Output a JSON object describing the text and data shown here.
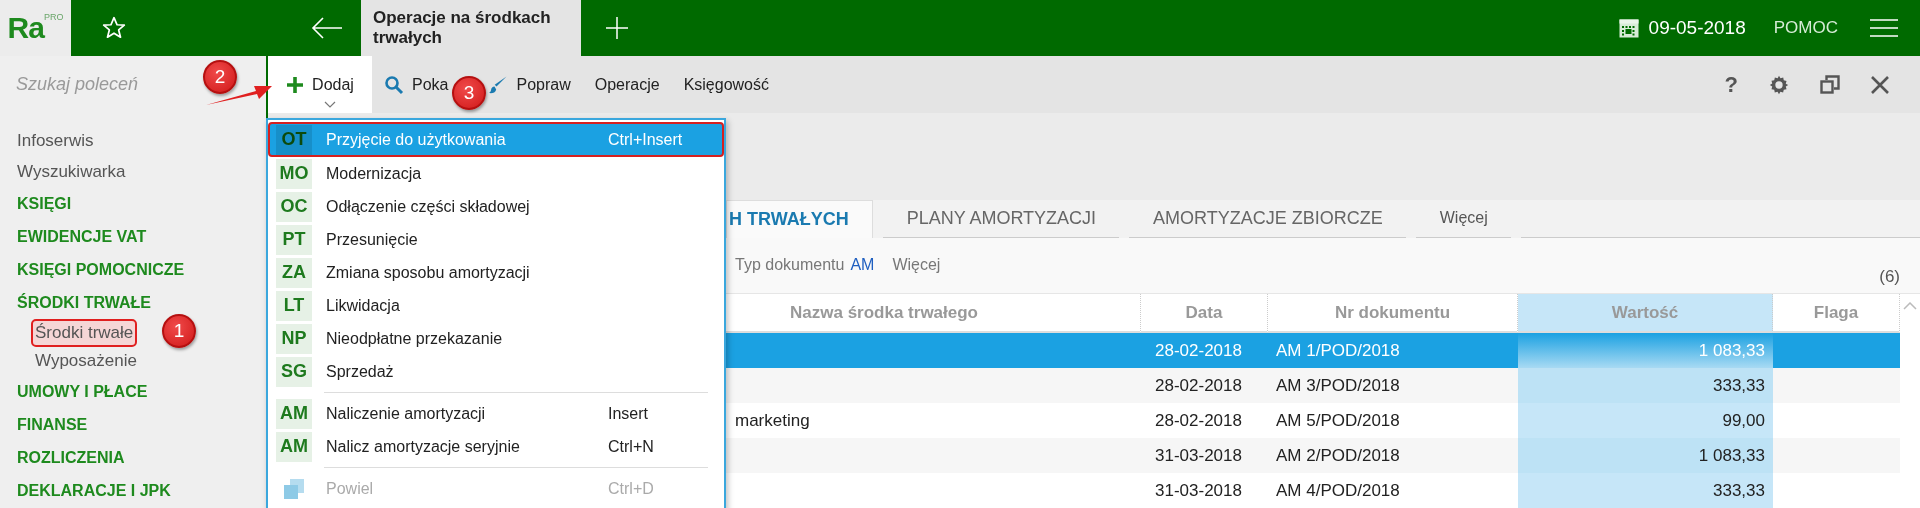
{
  "top_bar": {
    "logo": {
      "text": "Ra",
      "superscript": "PRO"
    },
    "document_tab": {
      "title": "Operacje na środkach trwałych"
    },
    "date": "09-05-2018",
    "help_link": "POMOC"
  },
  "search": {
    "placeholder": "Szukaj poleceń"
  },
  "toolbar": {
    "items": [
      {
        "label": "Dodaj",
        "expanded": true,
        "annotation": "2"
      },
      {
        "label": "Poka",
        "expanded": false
      },
      {
        "label": "Popraw",
        "expanded": false
      },
      {
        "label": "Operacje",
        "expanded": false
      },
      {
        "label": "Księgowość",
        "expanded": false
      }
    ],
    "help_button": "?"
  },
  "sidebar": {
    "items": [
      {
        "label": "Infoserwis",
        "kind": "link"
      },
      {
        "label": "Wyszukiwarka",
        "kind": "link"
      },
      {
        "label": "KSIĘGI",
        "kind": "section"
      },
      {
        "label": "EWIDENCJE VAT",
        "kind": "section"
      },
      {
        "label": "KSIĘGI POMOCNICZE",
        "kind": "section"
      },
      {
        "label": "ŚRODKI TRWAŁE",
        "kind": "section",
        "children": [
          {
            "label": "Środki trwałe",
            "annotation": "1"
          },
          {
            "label": "Wyposażenie"
          }
        ]
      },
      {
        "label": "UMOWY I PŁACE",
        "kind": "section"
      },
      {
        "label": "FINANSE",
        "kind": "section"
      },
      {
        "label": "ROZLICZENIA",
        "kind": "section"
      },
      {
        "label": "DEKLARACJE I JPK",
        "kind": "section"
      }
    ]
  },
  "menu": {
    "groups": [
      [
        {
          "code": "OT",
          "label": "Przyjęcie do użytkowania",
          "shortcut": "Ctrl+Insert",
          "selected": true,
          "disabled": false,
          "annotation": "3"
        },
        {
          "code": "MO",
          "label": "Modernizacja",
          "selected": false,
          "disabled": false
        },
        {
          "code": "OC",
          "label": "Odłączenie części składowej",
          "selected": false,
          "disabled": false
        },
        {
          "code": "PT",
          "label": "Przesunięcie",
          "selected": false,
          "disabled": false
        },
        {
          "code": "ZA",
          "label": "Zmiana sposobu amortyzacji",
          "selected": false,
          "disabled": false
        },
        {
          "code": "LT",
          "label": "Likwidacja",
          "selected": false,
          "disabled": false
        },
        {
          "code": "NP",
          "label": "Nieodpłatne przekazanie",
          "selected": false,
          "disabled": false
        },
        {
          "code": "SG",
          "label": "Sprzedaż",
          "selected": false,
          "disabled": false
        }
      ],
      [
        {
          "code": "AM",
          "label": "Naliczenie amortyzacji",
          "shortcut": "Insert",
          "selected": false,
          "disabled": false
        },
        {
          "code": "AM",
          "label": "Nalicz amortyzacje seryjnie",
          "shortcut": "Ctrl+N",
          "selected": false,
          "disabled": false
        }
      ],
      [
        {
          "label": "Powiel",
          "shortcut": "Ctrl+D",
          "selected": false,
          "disabled": true
        }
      ]
    ]
  },
  "tabs": [
    {
      "label": "H TRWAŁYCH",
      "selected": true
    },
    {
      "label": "PLANY AMORTYZACJI",
      "selected": false
    },
    {
      "label": "AMORTYZACJE ZBIORCZE",
      "selected": false
    },
    {
      "label": "Więcej",
      "selected": false
    }
  ],
  "filter": {
    "label": "Typ dokumentu",
    "value": "AM",
    "more": "Więcej",
    "count": "(6)"
  },
  "table": {
    "columns": [
      {
        "label": "Nazwa środka trwałego",
        "highlighted": false
      },
      {
        "label": "Data",
        "highlighted": false
      },
      {
        "label": "Nr dokumentu",
        "highlighted": false
      },
      {
        "label": "Wartość",
        "highlighted": true
      },
      {
        "label": "Flaga",
        "highlighted": false
      }
    ],
    "rows": [
      {
        "date": "28-02-2018",
        "document": "AM 1/POD/2018",
        "value": "1 083,33",
        "selected": true
      },
      {
        "date": "28-02-2018",
        "document": "AM 3/POD/2018",
        "value": "333,33",
        "selected": false
      },
      {
        "name": "marketing",
        "date": "28-02-2018",
        "document": "AM 5/POD/2018",
        "value": "99,00",
        "selected": false
      },
      {
        "date": "31-03-2018",
        "document": "AM 2/POD/2018",
        "value": "1 083,33",
        "selected": false
      },
      {
        "date": "31-03-2018",
        "document": "AM 4/POD/2018",
        "value": "333,33",
        "selected": false
      }
    ]
  }
}
